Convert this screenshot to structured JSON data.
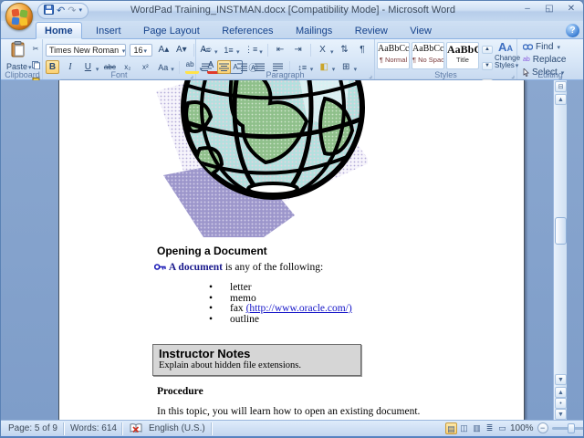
{
  "titlebar": {
    "title": "WordPad Training_INSTMAN.docx [Compatibility Mode] - Microsoft Word"
  },
  "tabs": [
    {
      "label": "Home"
    },
    {
      "label": "Insert"
    },
    {
      "label": "Page Layout"
    },
    {
      "label": "References"
    },
    {
      "label": "Mailings"
    },
    {
      "label": "Review"
    },
    {
      "label": "View"
    }
  ],
  "ribbon": {
    "clipboard": {
      "label": "Clipboard",
      "paste": "Paste"
    },
    "font": {
      "label": "Font",
      "name": "Times New Roman",
      "size": "16"
    },
    "paragraph": {
      "label": "Paragraph"
    },
    "styles": {
      "label": "Styles",
      "change_line1": "Change",
      "change_line2": "Styles",
      "items": [
        {
          "preview": "AaBbCcI",
          "name": "¶ Normal"
        },
        {
          "preview": "AaBbCcI",
          "name": "¶ No Spaci.."
        },
        {
          "preview": "AaBbC",
          "name": "Title"
        }
      ]
    },
    "editing": {
      "label": "Editing",
      "find": "Find",
      "replace": "Replace",
      "select": "Select"
    }
  },
  "icons": {
    "minimize": "–",
    "restore": "◱",
    "close": "✕",
    "help": "?",
    "caret": "▾",
    "undo": "↶",
    "redo": "↷",
    "cut": "✂",
    "bold": "B",
    "italic": "I",
    "underline": "U",
    "strike": "abc",
    "subscript": "x₂",
    "superscript": "x²",
    "case": "Aa",
    "highlight": "ab",
    "fontcolor": "A",
    "charborder": "A",
    "enclose": "Ⓐ",
    "growfont": "A▴",
    "shrinkfont": "A▾",
    "clearfmt": "A◌",
    "bullets": "•≡",
    "numbering": "1≡",
    "multilevel": "⋮≡",
    "outdent": "⇤",
    "indent": "⇥",
    "asian": "X",
    "sort": "⇅",
    "pilcrow": "¶",
    "linespacing": "↕≡",
    "shading": "◧",
    "borders": "⊞",
    "ruler": "⊟",
    "up": "▲",
    "down": "▼",
    "dot": "•",
    "view_print": "▤",
    "view_read": "◫",
    "view_web": "▥",
    "view_outline": "≣",
    "view_draft": "▭",
    "zoom_out": "−",
    "zoom_in": "+",
    "launcher": "⌟"
  },
  "document": {
    "heading": "Opening a Document",
    "term_bold": "A document",
    "term_rest": " is any of the following:",
    "bullets": {
      "b1": "letter",
      "b2": "memo",
      "b3_prefix": "fax ",
      "b3_link": "(http://www.oracle.com/)",
      "b4": "outline",
      "glyph": "•"
    },
    "notes_title": "Instructor Notes",
    "notes_body": "Explain about hidden file extensions.",
    "procedure": "Procedure",
    "body": "In this topic, you will learn how to open an existing document."
  },
  "statusbar": {
    "page": "Page: 5 of 9",
    "words": "Words: 614",
    "language": "English (U.S.)",
    "zoom": "100%"
  }
}
